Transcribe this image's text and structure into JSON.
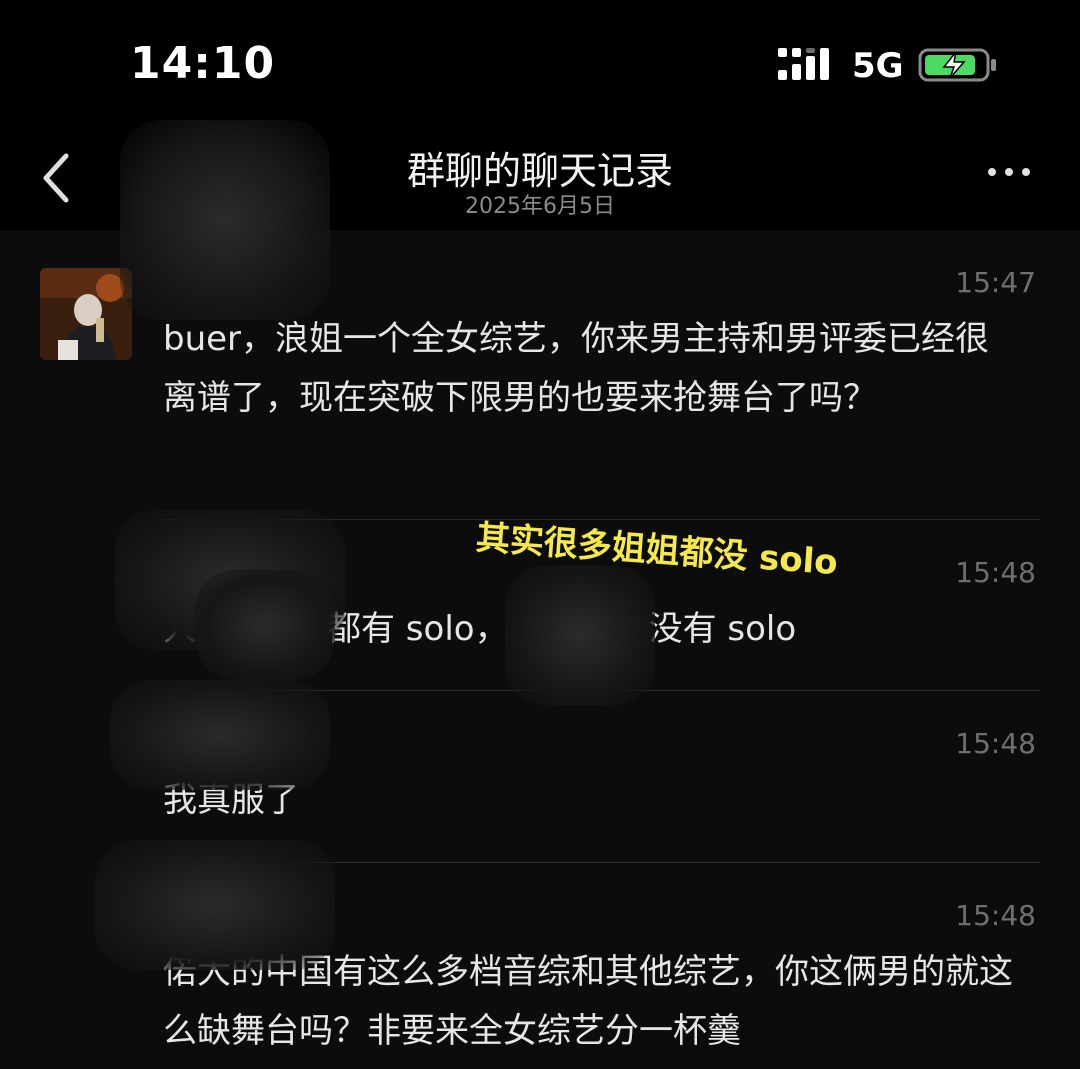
{
  "status_bar": {
    "time": "14:10",
    "network": "5G"
  },
  "nav": {
    "title": "群聊的聊天记录",
    "subtitle": "2025年6月5日"
  },
  "messages": [
    {
      "time": "15:47",
      "text": "buer，浪姐一个全女综艺，你来男主持和男评委已经很离谱了，现在突破下限男的也要来抢舞台了吗？"
    },
    {
      "time": "15:48",
      "text_part1": "人",
      "text_part2": "都有 solo，",
      "text_part3": "没有 solo"
    },
    {
      "time": "15:48",
      "text": "我真服了"
    },
    {
      "time": "15:48",
      "text": "偌大的中国有这么多档音综和其他综艺，你这俩男的就这么缺舞台吗？非要来全女综艺分一杯羹"
    }
  ],
  "annotation": "其实很多姐姐都没 solo",
  "colors": {
    "background": "#000000",
    "chat_background": "#0c0c0c",
    "annotation": "#f6e94b",
    "battery_fill": "#4cd964"
  }
}
